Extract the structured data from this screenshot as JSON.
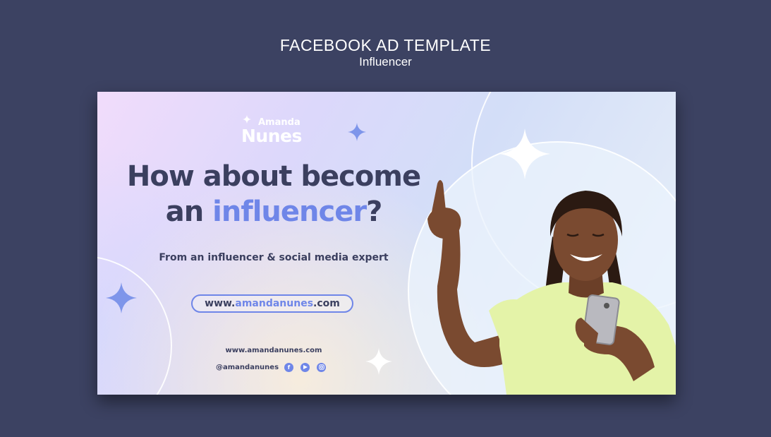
{
  "page": {
    "title": "FACEBOOK AD TEMPLATE",
    "subtitle": "Influencer"
  },
  "ad": {
    "brand_first": "Amanda",
    "brand_last": "Nunes",
    "headline_line1": "How about become",
    "headline_line2_prefix": "an ",
    "headline_line2_accent": "influencer",
    "headline_line2_suffix": "?",
    "tagline": "From an influencer & social media expert",
    "url_prefix": "www.",
    "url_accent": "amandanunes",
    "url_suffix": ".com",
    "small_url": "www.amandanunes.com",
    "handle": "@amandanunes",
    "social_icons": [
      "facebook-icon",
      "youtube-icon",
      "instagram-icon"
    ]
  },
  "colors": {
    "background": "#3c4262",
    "text_dark": "#3b3f5f",
    "accent": "#6f86e8",
    "shirt": "#e4f3a8",
    "skin": "#7a4a30"
  }
}
